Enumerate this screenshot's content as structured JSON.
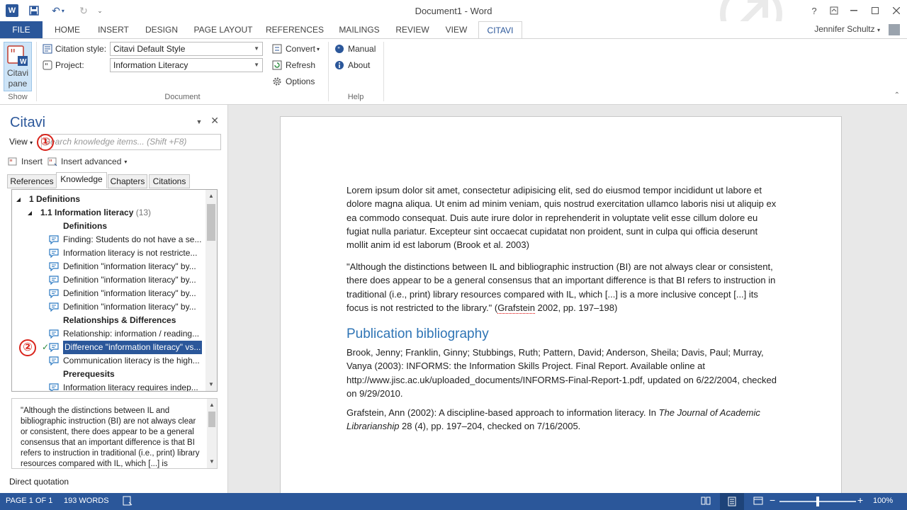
{
  "window": {
    "title": "Document1 - Word",
    "help": "?",
    "app_icon_letter": "W"
  },
  "ribbon_tabs": [
    "FILE",
    "HOME",
    "INSERT",
    "DESIGN",
    "PAGE LAYOUT",
    "REFERENCES",
    "MAILINGS",
    "REVIEW",
    "VIEW",
    "CITAVI"
  ],
  "active_tab": "CITAVI",
  "user": "Jennifer Schultz",
  "ribbon": {
    "show_group": {
      "label": "Show",
      "button_line1": "Citavi",
      "button_line2": "pane"
    },
    "document_group": {
      "label": "Document",
      "citation_style_label": "Citation style:",
      "citation_style_value": "Citavi Default Style",
      "project_label": "Project:",
      "project_value": "Information Literacy",
      "convert": "Convert",
      "refresh": "Refresh",
      "options": "Options"
    },
    "help_group": {
      "label": "Help",
      "manual": "Manual",
      "about": "About"
    }
  },
  "pane": {
    "title": "Citavi",
    "view_label": "View",
    "search_placeholder": "Search knowledge items... (Shift +F8)",
    "callout_1": "①",
    "callout_2": "②",
    "insert": "Insert",
    "insert_advanced": "Insert advanced",
    "tabs": [
      "References",
      "Knowledge",
      "Chapters",
      "Citations"
    ],
    "active_tab": "Knowledge",
    "tree": [
      {
        "text": "1 Definitions",
        "level": 0,
        "bold": true,
        "expander": "◢"
      },
      {
        "text": "1.1 Information literacy",
        "count": "(13)",
        "level": 1,
        "bold": true,
        "expander": "◢"
      },
      {
        "text": "Definitions",
        "level": 2,
        "bold": true
      },
      {
        "text": "Finding: Students do not have a se...",
        "level": 2,
        "icon": true
      },
      {
        "text": "Information literacy is not restricte...",
        "level": 2,
        "icon": true
      },
      {
        "text": "Definition \"information literacy\" by...",
        "level": 2,
        "icon": true
      },
      {
        "text": "Definition \"information literacy\" by...",
        "level": 2,
        "icon": true
      },
      {
        "text": "Definition \"information literacy\" by...",
        "level": 2,
        "icon": true
      },
      {
        "text": "Definition \"information literacy\" by...",
        "level": 2,
        "icon": true
      },
      {
        "text": "Relationships & Differences",
        "level": 2,
        "bold": true
      },
      {
        "text": "Relationship: information / reading...",
        "level": 2,
        "icon": true
      },
      {
        "text": "Difference \"information literacy\" vs...",
        "level": 2,
        "icon": true,
        "selected": true,
        "checked": true
      },
      {
        "text": "Communication literacy is the high...",
        "level": 2,
        "icon": true
      },
      {
        "text": "Prerequesits",
        "level": 2,
        "bold": true
      },
      {
        "text": "Information literacy requires indep...",
        "level": 2,
        "icon": true
      }
    ],
    "quote_text": "\"Although the distinctions between IL and bibliographic instruction (BI) are not always clear or consistent, there does appear to be a general consensus that an important difference is that BI refers to instruction in traditional (i.e., print) library resources compared with IL, which [...] is",
    "quote_type": "Direct quotation"
  },
  "document": {
    "para1": "Lorem ipsum dolor sit amet, consectetur adipisicing elit, sed do eiusmod tempor incididunt ut labore et dolore magna aliqua. Ut enim ad minim veniam, quis nostrud exercitation ullamco laboris nisi ut aliquip ex ea commodo consequat. Duis aute irure dolor in reprehenderit in voluptate velit esse cillum dolore eu fugiat nulla pariatur. Excepteur sint occaecat cupidatat non proident, sunt in culpa qui officia deserunt mollit anim id est laborum (Brook et al. 2003)",
    "para2_main": "\"Although the distinctions between IL and bibliographic instruction (BI) are not always clear or consistent, there does appear to be a general consensus that an important difference is that BI refers to instruction in traditional (i.e., print) library resources compared with IL, which [...] is a more inclusive concept [...] its focus is not restricted to the library.\" (",
    "para2_author": "Grafstein",
    "para2_end": " 2002, pp. 197–198)",
    "bib_heading": "Publication bibliography",
    "bib1": "Brook, Jenny; Franklin, Ginny; Stubbings, Ruth; Pattern, David; Anderson, Sheila; Davis, Paul; Murray, Vanya (2003): INFORMS: the Information Skills Project. Final Report. Available online at http://www.jisc.ac.uk/uploaded_documents/INFORMS-Final-Report-1.pdf, updated on 6/22/2004, checked on 9/29/2010.",
    "bib2_start": "Grafstein, Ann (2002): A discipline-based approach to information literacy. In ",
    "bib2_journal": "The Journal of Academic Librarianship",
    "bib2_end": " 28 (4), pp. 197–204, checked on 7/16/2005."
  },
  "status": {
    "page": "PAGE 1 OF 1",
    "words": "193 WORDS",
    "zoom": "100%",
    "zoom_level_percent": 100
  },
  "colors": {
    "accent": "#2b579a",
    "callout": "#d9241c",
    "heading": "#2e74b5"
  }
}
